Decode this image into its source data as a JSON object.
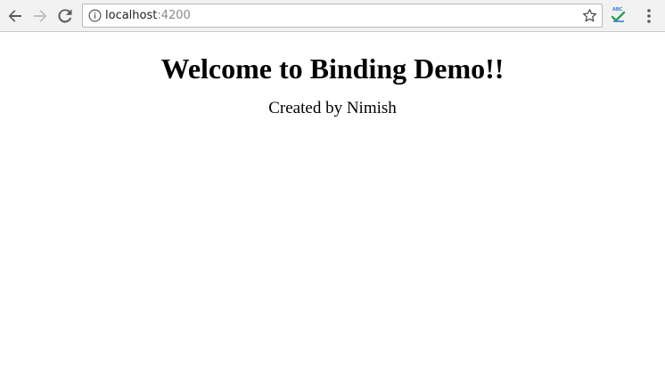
{
  "browser": {
    "address_bar": {
      "host": "localhost",
      "port": ":4200"
    },
    "icons": {
      "back": "arrow-left-icon",
      "forward": "arrow-right-icon",
      "reload": "reload-icon",
      "info": "info-icon",
      "bookmark": "star-icon",
      "extension": "spellcheck-extension-icon",
      "menu": "kebab-menu-icon"
    },
    "extension_label": "ABC"
  },
  "page": {
    "title": "Welcome to Binding Demo!!",
    "subtitle": "Created by Nimish"
  }
}
